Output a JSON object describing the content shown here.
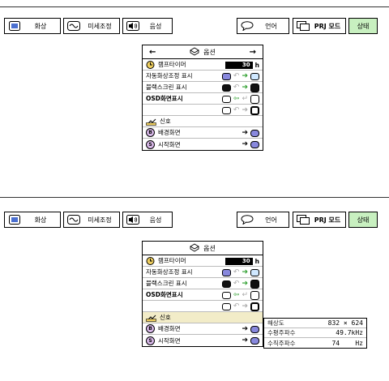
{
  "tabs": {
    "picture": "화상",
    "fine_sync": "미세조정",
    "audio": "음성",
    "language": "언어",
    "prj_mode": "PRJ 모드",
    "status": "상태"
  },
  "menu": {
    "title": "옵션",
    "lamp_timer": {
      "label": "램프타이머",
      "value": "30",
      "unit": "h"
    },
    "auto_sync": {
      "label": "자동화상조정 표시"
    },
    "blackscreen": {
      "label": "블랙스크린 표시"
    },
    "osd": {
      "label": "OSD화면표시"
    },
    "dimmed_label": "",
    "signal": {
      "label": "신호"
    },
    "background": {
      "label": "배경화면",
      "badge": "B"
    },
    "startup": {
      "label": "시작화면",
      "badge": "S"
    },
    "arrow_left": "←",
    "arrow_right": "→"
  },
  "info_panel": {
    "rows": [
      {
        "key": "해상도",
        "value": "832 × 624"
      },
      {
        "key": "수평주파수",
        "value": "49.7kHz"
      },
      {
        "key": "수직주파수",
        "value": "74    Hz"
      }
    ]
  },
  "colors": {
    "status_tab": "#c8f0c0",
    "selected_row": "#f2ecc8",
    "swatch_blue": "#8888dd",
    "arrow_green": "#2a9d2a"
  }
}
